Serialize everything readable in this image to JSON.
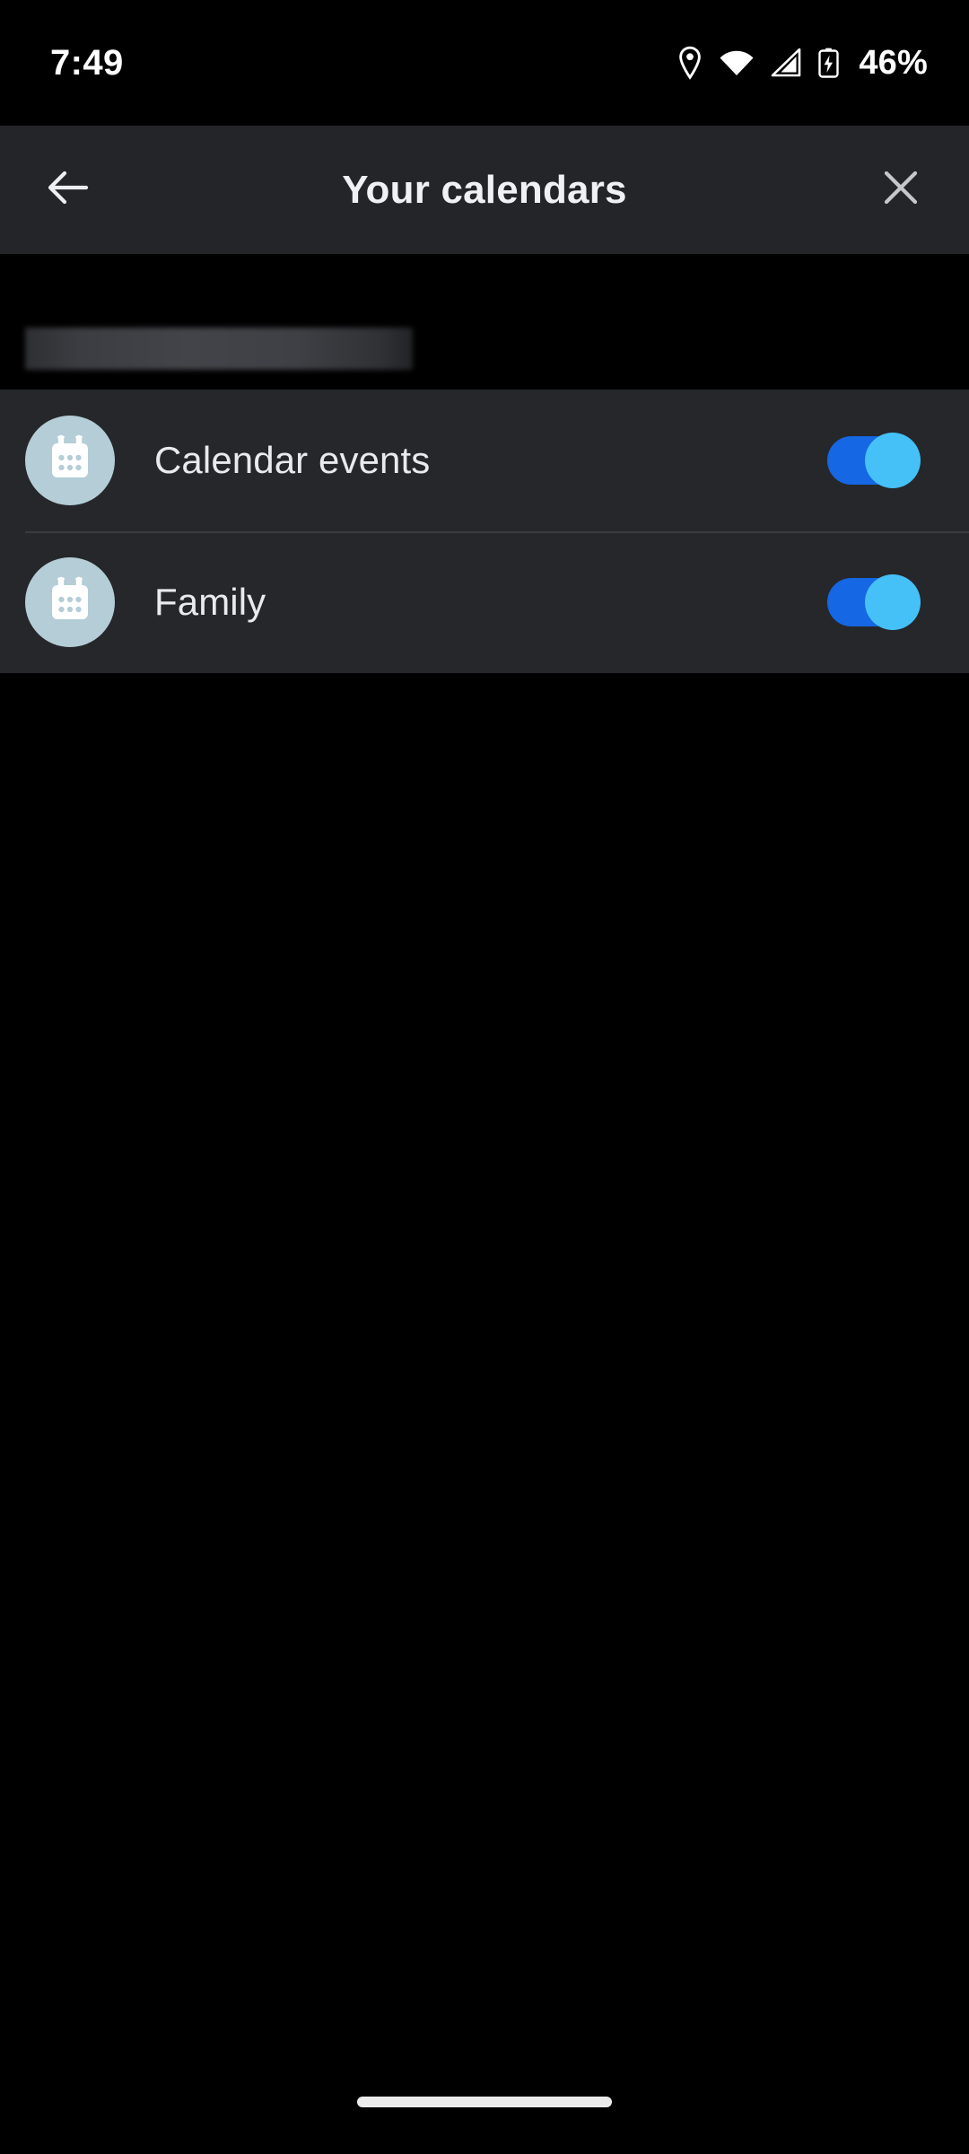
{
  "status_bar": {
    "time": "7:49",
    "battery_percent": "46%",
    "icons": [
      "location-pin-icon",
      "wifi-icon",
      "cellular-signal-icon",
      "battery-charging-icon"
    ]
  },
  "header": {
    "title": "Your calendars",
    "back_label": "back-arrow-icon",
    "close_label": "close-icon"
  },
  "account": {
    "email_redacted": ""
  },
  "calendars": {
    "items": [
      {
        "name": "Calendar events",
        "enabled": "on",
        "icon": "calendar-icon"
      },
      {
        "name": "Family",
        "enabled": "on",
        "icon": "calendar-icon"
      }
    ]
  },
  "colors": {
    "page_background": "#000000",
    "header_background": "#242529",
    "row_background": "#26272b",
    "divider": "#3a3b40",
    "avatar_background": "#b4cdd6",
    "toggle_track_on": "#1567e3",
    "toggle_thumb_on": "#45c1f7",
    "primary_text": "#e9eaee",
    "gesture_bar": "#ebebeb"
  },
  "navigation": {
    "gesture_bar": "home-gesture-bar"
  }
}
